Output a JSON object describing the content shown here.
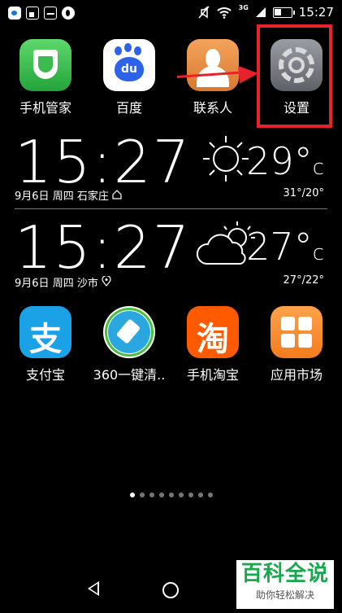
{
  "status_bar": {
    "time": "15:27",
    "network": "3G",
    "icons_left": [
      "paw-notification-icon",
      "battery-notification-icon",
      "image-notification-icon",
      "app-notification-icon"
    ],
    "icons_right": [
      "mute-icon",
      "wifi-icon",
      "signal-icon",
      "battery-icon"
    ]
  },
  "apps_row1": [
    {
      "label": "手机管家",
      "icon": "shield-icon"
    },
    {
      "label": "百度",
      "icon": "baidu-paw-icon",
      "icon_text": "du"
    },
    {
      "label": "联系人",
      "icon": "contacts-icon"
    },
    {
      "label": "设置",
      "icon": "gear-icon"
    }
  ],
  "weather_widgets": [
    {
      "time": "15:27",
      "date": "9月6日",
      "weekday": "周四",
      "city": "石家庄",
      "location_icon": "home-icon",
      "weather_icon": "sun-icon",
      "temperature": "29°",
      "unit": "c",
      "range": "31°/20°"
    },
    {
      "time": "15:27",
      "date": "9月6日",
      "weekday": "周四",
      "city": "沙市",
      "location_icon": "location-pin-icon",
      "weather_icon": "partly-cloudy-icon",
      "temperature": "27°",
      "unit": "c",
      "range": "27°/22°"
    }
  ],
  "apps_row2": [
    {
      "label": "支付宝",
      "icon": "alipay-icon",
      "icon_text": "支"
    },
    {
      "label": "360一键清..",
      "icon": "broom-icon"
    },
    {
      "label": "手机淘宝",
      "icon": "taobao-icon",
      "icon_text": "淘"
    },
    {
      "label": "应用市场",
      "icon": "app-market-icon"
    }
  ],
  "page_indicator": {
    "count": 9,
    "active": 1
  },
  "nav_bar": {
    "icons": [
      "back-icon",
      "home-icon"
    ]
  },
  "watermark": {
    "title": "百科全说",
    "subtitle": "助你轻松解决"
  },
  "colors": {
    "highlight": "#e6232b",
    "watermark_green": "#19a84b"
  }
}
